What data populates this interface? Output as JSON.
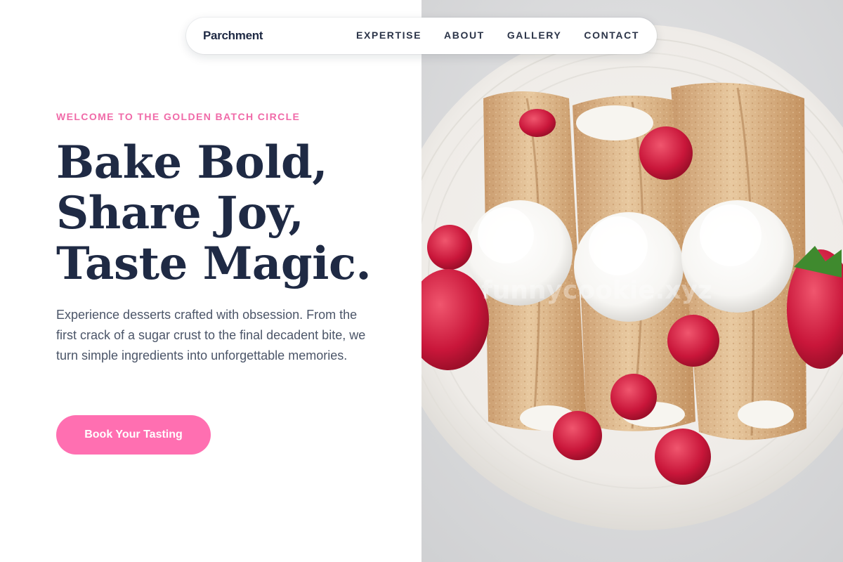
{
  "nav": {
    "brand": "Parchment",
    "links": [
      "EXPERTISE",
      "ABOUT",
      "GALLERY",
      "CONTACT"
    ]
  },
  "hero": {
    "eyebrow": "WELCOME TO THE GOLDEN BATCH CIRCLE",
    "headline": [
      "Bake Bold,",
      "Share Joy,",
      "Taste Magic."
    ],
    "description": "Experience desserts crafted with obsession. From the first crack of a sugar crust to the final decadent bite, we turn simple ingredients into unforgettable memories.",
    "cta_label": "Book Your Tasting",
    "image_watermark": "funnycookie.xyz"
  },
  "colors": {
    "accent": "#ff6fb1",
    "eyebrow": "#f06aa8",
    "heading": "#1f2a44",
    "body": "#4b5568"
  }
}
